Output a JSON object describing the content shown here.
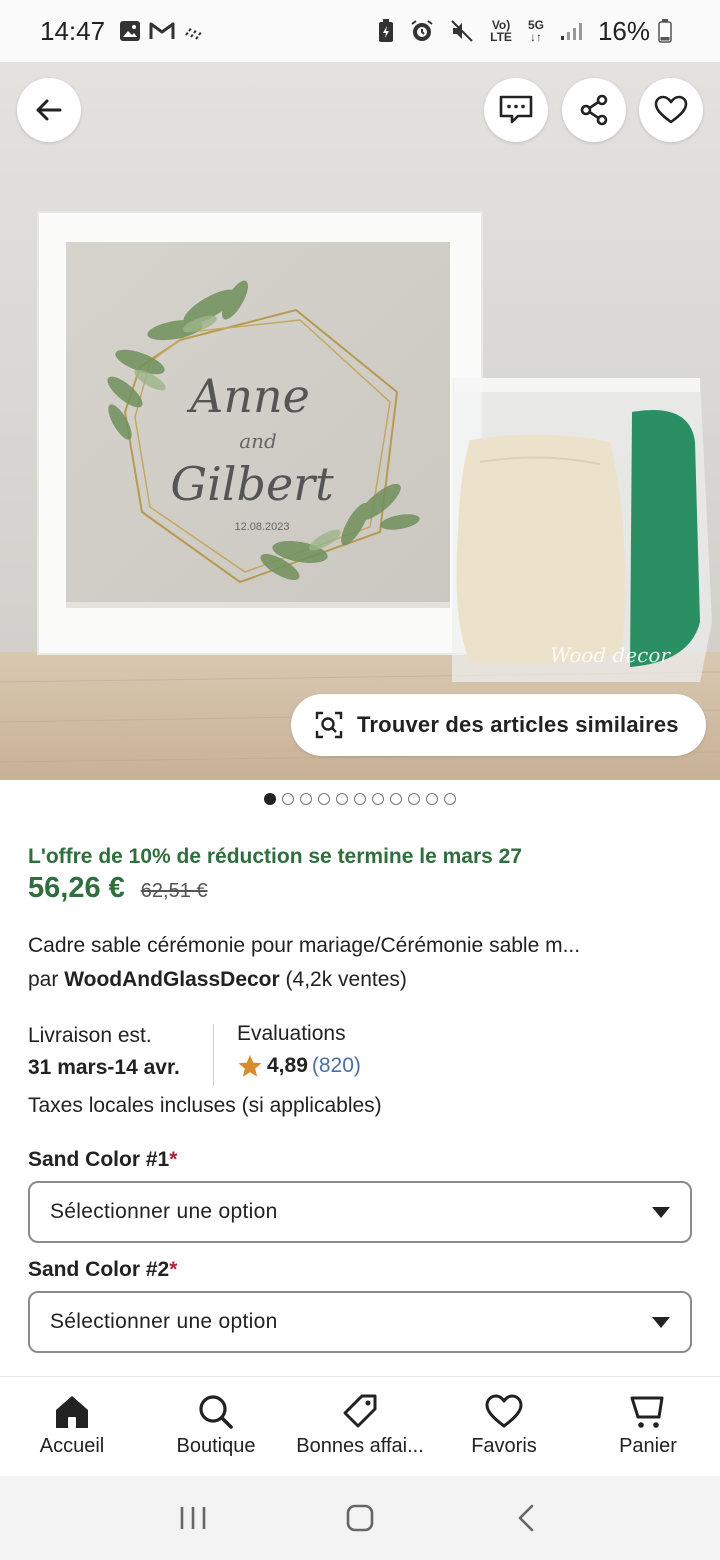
{
  "status_bar": {
    "time": "14:47",
    "battery": "16%",
    "network_label_top": "Vo)",
    "network_label_bottom": "LTE",
    "network_5g": "5G"
  },
  "hero": {
    "frame_text_line1": "Anne",
    "frame_text_line2": "and",
    "frame_text_line3": "Gilbert",
    "frame_date": "12.08.2023",
    "watermark": "Wood decor",
    "similar_button_label": "Trouver des articles similaires",
    "dots_total": 11,
    "dots_active_index": 0
  },
  "product": {
    "offer_text": "L'offre de 10% de réduction se termine le mars 27",
    "price": "56,26 €",
    "old_price": "62,51 €",
    "title": "Cadre sable cérémonie pour mariage/Cérémonie sable m...",
    "seller_prefix": "par",
    "seller_name": "WoodAndGlassDecor",
    "seller_sales": "(4,2k ventes)",
    "delivery_label": "Livraison est.",
    "delivery_date": "31 mars-14 avr.",
    "reviews_label": "Evaluations",
    "rating": "4,89",
    "review_count": "(820)",
    "taxes_text": "Taxes locales incluses (si applicables)"
  },
  "options": [
    {
      "label": "Sand Color #1",
      "required_mark": "*",
      "value": "Sélectionner une option"
    },
    {
      "label": "Sand Color #2",
      "required_mark": "*",
      "value": "Sélectionner une option"
    }
  ],
  "bottom_nav": {
    "items": [
      {
        "label": "Accueil",
        "icon": "home-icon"
      },
      {
        "label": "Boutique",
        "icon": "search-icon"
      },
      {
        "label": "Bonnes affai...",
        "icon": "tag-icon"
      },
      {
        "label": "Favoris",
        "icon": "heart-icon"
      },
      {
        "label": "Panier",
        "icon": "cart-icon"
      }
    ]
  },
  "colors": {
    "offer_green": "#2f6e3d",
    "review_link": "#4a6fa5",
    "required_red": "#b0213b",
    "star": "#d98a2b"
  }
}
